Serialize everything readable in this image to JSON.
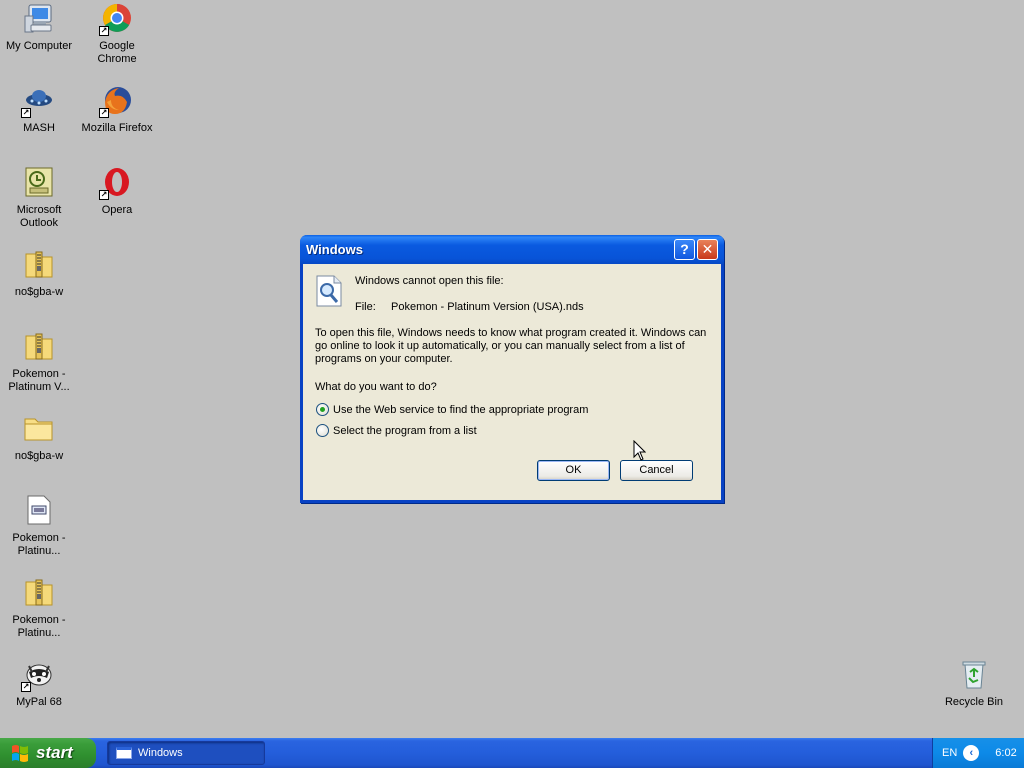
{
  "desktop_icons": [
    {
      "name": "My Computer"
    },
    {
      "name": "Google Chrome"
    },
    {
      "name": "MASH"
    },
    {
      "name": "Mozilla Firefox"
    },
    {
      "name": "Microsoft Outlook"
    },
    {
      "name": "Opera"
    },
    {
      "name": "no$gba-w"
    },
    {
      "name": "Pokemon - Platinum V..."
    },
    {
      "name": "no$gba-w"
    },
    {
      "name": "Pokemon - Platinu..."
    },
    {
      "name": "Pokemon - Platinu..."
    },
    {
      "name": "MyPal 68"
    },
    {
      "name": "Recycle Bin"
    }
  ],
  "dialog": {
    "title": "Windows",
    "help_glyph": "?",
    "close_glyph": "✕",
    "message": "Windows cannot open this file:",
    "file_label": "File:",
    "file_name": "Pokemon - Platinum Version (USA).nds",
    "explanation": "To open this file, Windows needs to know what program created it.  Windows can go online to look it up automatically, or you can manually select from a list of programs on your computer.",
    "question": "What do you want to do?",
    "options": [
      {
        "label": "Use the Web service to find the appropriate program",
        "checked": true
      },
      {
        "label": "Select the program from a list",
        "checked": false
      }
    ],
    "ok_label": "OK",
    "cancel_label": "Cancel",
    "icon": "file-search-icon"
  },
  "taskbar": {
    "start_label": "start",
    "tasks": [
      {
        "label": "Windows",
        "active": true
      }
    ],
    "language": "EN",
    "clock": "6:02"
  },
  "colors": {
    "desktop_bg": "#c0c0c0",
    "title_bar": "#0a5ae0",
    "dialog_bg": "#ece9d8",
    "taskbar": "#245edb",
    "start_button": "#3a9d3a",
    "tray": "#0d8ae8"
  }
}
